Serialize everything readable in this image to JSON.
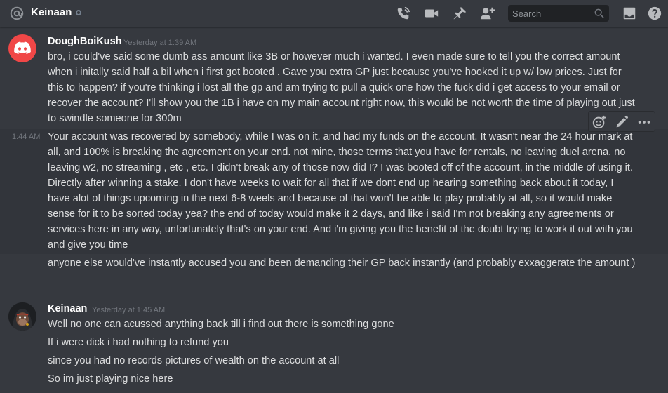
{
  "header": {
    "channel_name": "Keinaan",
    "search_placeholder": "Search",
    "icons": [
      "at-icon",
      "status-idle-icon",
      "call-icon",
      "video-icon",
      "pin-icon",
      "add-friend-icon",
      "search-icon",
      "inbox-icon",
      "help-icon"
    ]
  },
  "messages": [
    {
      "author": "DoughBoiKush",
      "timestamp": "Yesterday at 1:39 AM",
      "avatar_icon": "discord-logo-icon",
      "avatar_color": "#f04747",
      "lines": [
        "bro, i could've said some dumb ass amount like 3B or however much i wanted. I even made sure to tell you the correct amount when i initally said half a bil when i first got booted . Gave you extra GP just because you've hooked it up w/ low prices. Just for this to happen? if you're thinking i lost all the gp and am trying to pull a quick one how the fuck did i get access to your email or recover the account? I'll show you the 1B i have on my main account right now, this would be not worth the time of playing out just to swindle someone for 300m"
      ]
    },
    {
      "hover_time": "1:44 AM",
      "lines": [
        "Your account was recovered by somebody, while I was on it, and had my funds on the account. It wasn't near the 24 hour mark at all, and 100% is breaking the agreement on your end. not mine, those terms that you have for rentals, no leaving duel arena, no leaving w2, no streaming , etc , etc. I didn't break any of those now did I? I  was booted off of the account, in the middle of using it. Directly after winning a stake. I don't have weeks to wait for all that if we dont end up hearing something back about it today, I have alot of things upcoming in the next 6-8 weels and because of that won't be able to play probably at all, so it would make sense for it to be sorted today yea? the end of today would make it 2 days, and like i said I'm not breaking any agreements or services here in any way, unfortunately that's on your end. And i'm giving you the benefit of the doubt trying to work it out with you and give you time"
      ]
    },
    {
      "lines": [
        "anyone else would've instantly accused you and been demanding their GP back instantly (and probably exxaggerate the amount )"
      ]
    },
    {
      "author": "Keinaan",
      "timestamp": "Yesterday at 1:45 AM",
      "avatar_icon": "hooded-ape-avatar-icon",
      "lines": [
        "Well no one can acussed anything back till i find out there is something gone",
        "If i were dick i had nothing to refund you",
        "since you had no records pictures of wealth on the account at all",
        "So im just playing nice here"
      ]
    }
  ],
  "toolbar": {
    "icons": [
      "add-reaction-icon",
      "edit-icon",
      "more-icon"
    ]
  },
  "colors": {
    "background": "#36393f",
    "header_text": "#ffffff",
    "message_text": "#dcddde",
    "timestamp": "#72767d",
    "search_bg": "#202225"
  }
}
